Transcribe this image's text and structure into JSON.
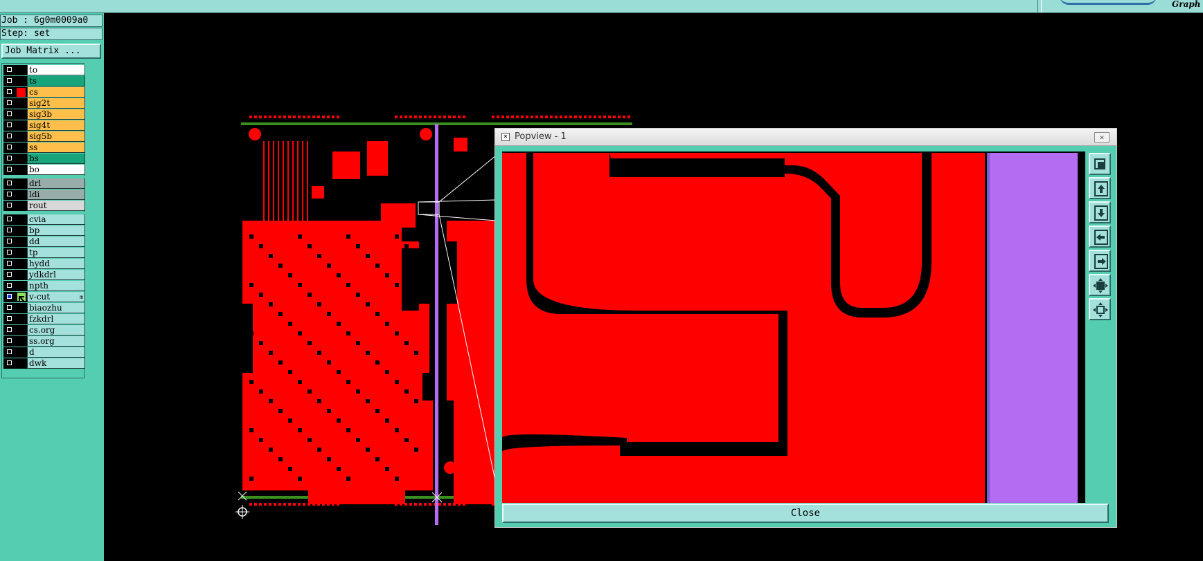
{
  "header": {
    "brand_fragment": "Graph"
  },
  "job": {
    "job_label": "Job : 6g0m0009a0",
    "step_label": "Step: set",
    "matrix_button": "Job Matrix ..."
  },
  "layers": [
    {
      "name": "to",
      "bg": "#ffffff",
      "color": "#000000",
      "checked": false
    },
    {
      "name": "ts",
      "bg": "#18a57c",
      "color": "#000000",
      "checked": false
    },
    {
      "name": "cs",
      "bg": "#ffbf4a",
      "color": "#ff0000",
      "checked": false
    },
    {
      "name": "sig2t",
      "bg": "#ffbf4a",
      "color": "#000000",
      "checked": false
    },
    {
      "name": "sig3b",
      "bg": "#ffbf4a",
      "color": "#000000",
      "checked": false
    },
    {
      "name": "sig4t",
      "bg": "#ffbf4a",
      "color": "#000000",
      "checked": false
    },
    {
      "name": "sig5b",
      "bg": "#ffbf4a",
      "color": "#000000",
      "checked": false
    },
    {
      "name": "ss",
      "bg": "#ffbf4a",
      "color": "#000000",
      "checked": false
    },
    {
      "name": "bs",
      "bg": "#18a57c",
      "color": "#000000",
      "checked": false
    },
    {
      "name": "bo",
      "bg": "#ffffff",
      "color": "#000000",
      "checked": false
    },
    {
      "name": "drl",
      "bg": "#98adaa",
      "color": "#000000",
      "checked": false,
      "group_gap": true
    },
    {
      "name": "ldi",
      "bg": "#98adaa",
      "color": "#000000",
      "checked": false
    },
    {
      "name": "rout",
      "bg": "#d8d8d8",
      "color": "#000000",
      "checked": false
    },
    {
      "name": "cvia",
      "bg": "#a4e0dc",
      "color": "#000000",
      "checked": false,
      "group_gap": true
    },
    {
      "name": "bp",
      "bg": "#a4e0dc",
      "color": "#000000",
      "checked": false
    },
    {
      "name": "dd",
      "bg": "#a4e0dc",
      "color": "#000000",
      "checked": false
    },
    {
      "name": "tp",
      "bg": "#a4e0dc",
      "color": "#000000",
      "checked": false
    },
    {
      "name": "hydd",
      "bg": "#a4e0dc",
      "color": "#000000",
      "checked": false
    },
    {
      "name": "ydkdrl",
      "bg": "#a4e0dc",
      "color": "#000000",
      "checked": false
    },
    {
      "name": "npth",
      "bg": "#a4e0dc",
      "color": "#000000",
      "checked": false
    },
    {
      "name": "v-cut",
      "bg": "#a4e0dc",
      "color": "#000000",
      "checked": true,
      "active": true,
      "mark": "m"
    },
    {
      "name": "biaozhu",
      "bg": "#a4e0dc",
      "color": "#000000",
      "checked": false
    },
    {
      "name": "fzkdrl",
      "bg": "#a4e0dc",
      "color": "#000000",
      "checked": false
    },
    {
      "name": "cs.org",
      "bg": "#a4e0dc",
      "color": "#000000",
      "checked": false
    },
    {
      "name": "ss.org",
      "bg": "#a4e0dc",
      "color": "#000000",
      "checked": false
    },
    {
      "name": "d",
      "bg": "#a4e0dc",
      "color": "#000000",
      "checked": false
    },
    {
      "name": "dwk",
      "bg": "#a4e0dc",
      "color": "#000000",
      "checked": false
    }
  ],
  "popview": {
    "title": "Popview - 1",
    "close_label": "Close",
    "tools": [
      "zoom-window-icon",
      "zoom-in-icon",
      "zoom-out-icon",
      "pan-left-icon",
      "pan-right-icon",
      "fit-home-icon",
      "fit-all-icon"
    ]
  },
  "colors": {
    "copper": "#ff0000",
    "vcut_line": "#b36cf2",
    "profile_line": "#3a8f1f",
    "panel_teal": "#55cdb1",
    "button_teal": "#a4e0dc"
  }
}
